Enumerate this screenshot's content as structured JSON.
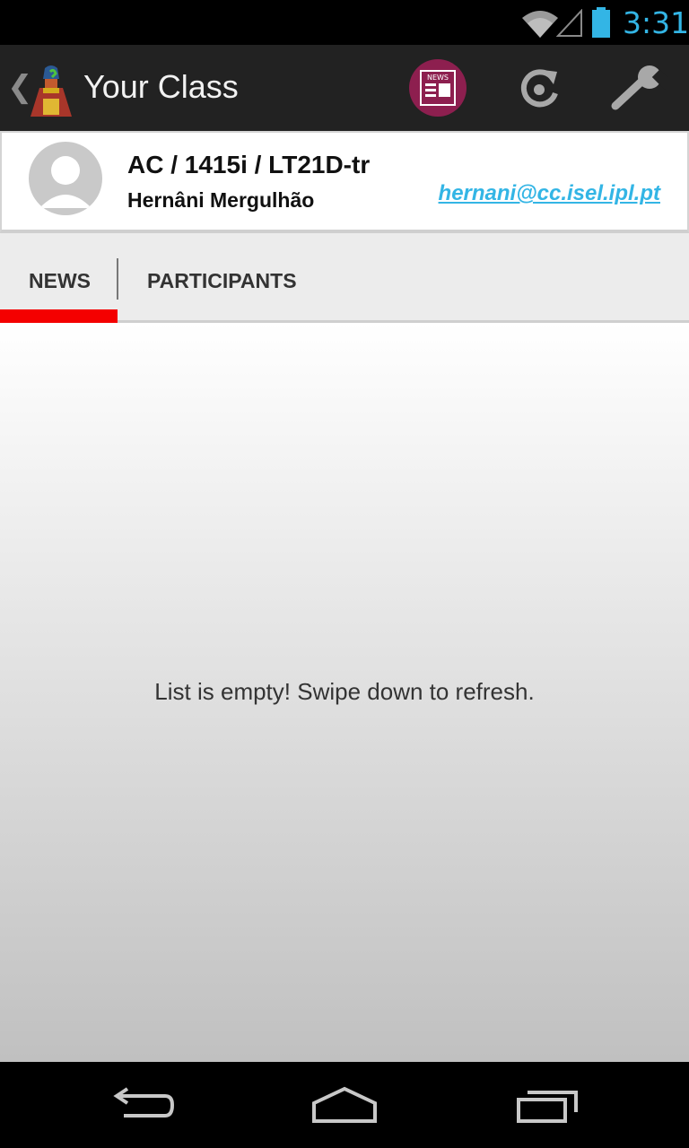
{
  "status_bar": {
    "time": "3:31",
    "time_color": "#33b5e5"
  },
  "action_bar": {
    "title": "Your Class",
    "up_icon": "chevron-left-icon",
    "actions": [
      {
        "name": "news",
        "icon": "newspaper-icon",
        "icon_text": "NEWS",
        "accent": "#8d1f4f"
      },
      {
        "name": "refresh",
        "icon": "refresh-icon"
      },
      {
        "name": "settings",
        "icon": "wrench-icon"
      }
    ]
  },
  "class_header": {
    "class_name": "AC / 1415i / LT21D-tr",
    "teacher_name": "Hernâni Mergulhão",
    "teacher_email": "hernani@cc.isel.ipl.pt"
  },
  "tabs": [
    {
      "label": "NEWS",
      "selected": true
    },
    {
      "label": "PARTICIPANTS",
      "selected": false
    }
  ],
  "tab_indicator_color": "#f40000",
  "news_list": {
    "empty_message": "List is empty! Swipe down to refresh."
  },
  "nav_bar": {
    "buttons": [
      "back-icon",
      "home-icon",
      "recents-icon"
    ]
  }
}
